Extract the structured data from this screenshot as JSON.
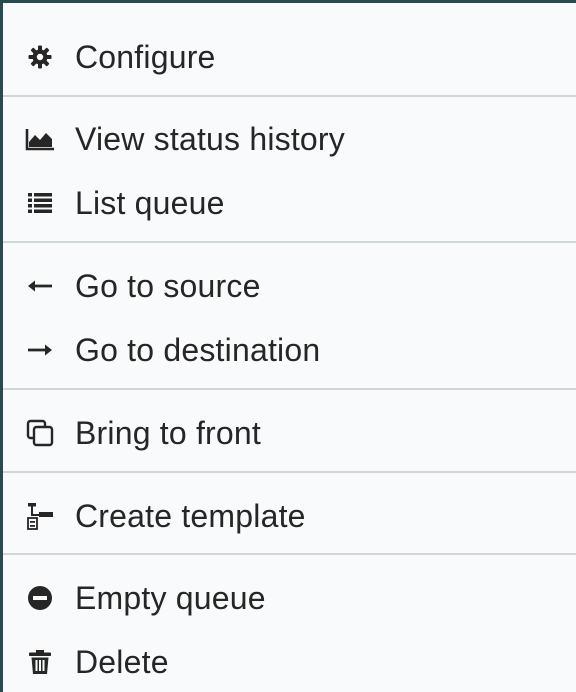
{
  "menu": {
    "items": [
      {
        "label": "Configure",
        "icon": "gear-icon"
      },
      {
        "label": "View status history",
        "icon": "area-chart-icon"
      },
      {
        "label": "List queue",
        "icon": "list-icon"
      },
      {
        "label": "Go to source",
        "icon": "arrow-left-icon"
      },
      {
        "label": "Go to destination",
        "icon": "arrow-right-icon"
      },
      {
        "label": "Bring to front",
        "icon": "clone-icon"
      },
      {
        "label": "Create template",
        "icon": "template-icon"
      },
      {
        "label": "Empty queue",
        "icon": "minus-circle-icon"
      },
      {
        "label": "Delete",
        "icon": "trash-icon"
      }
    ]
  }
}
